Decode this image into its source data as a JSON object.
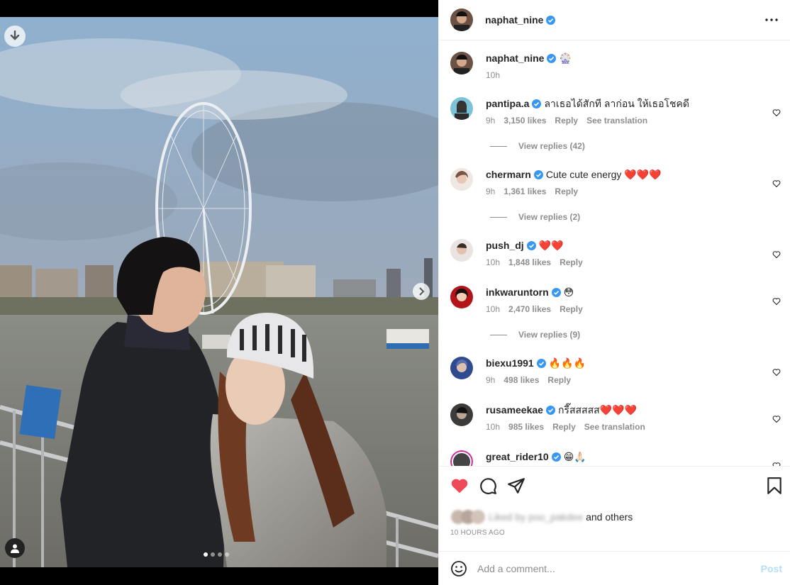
{
  "post": {
    "author": "naphat_nine",
    "caption_emoji": "🎡",
    "caption_time": "10h"
  },
  "comments": [
    {
      "user": "pantipa.a",
      "text": "ลาเธอได้สักที ลาก่อน ให้เธอโชคดี",
      "time": "9h",
      "likes": "3,150 likes",
      "reply": "Reply",
      "translate": "See translation",
      "replies": "View replies (42)"
    },
    {
      "user": "chermarn",
      "text": "Cute cute energy ❤️❤️❤️",
      "time": "9h",
      "likes": "1,361 likes",
      "reply": "Reply",
      "replies": "View replies (2)"
    },
    {
      "user": "push_dj",
      "text": "❤️❤️",
      "time": "10h",
      "likes": "1,848 likes",
      "reply": "Reply"
    },
    {
      "user": "inkwaruntorn",
      "text": "😳",
      "time": "10h",
      "likes": "2,470 likes",
      "reply": "Reply",
      "replies": "View replies (9)"
    },
    {
      "user": "biexu1991",
      "text": "🔥🔥🔥",
      "time": "9h",
      "likes": "498 likes",
      "reply": "Reply"
    },
    {
      "user": "rusameekae",
      "text": "กรี๊สสสสส❤️❤️❤️",
      "time": "10h",
      "likes": "985 likes",
      "reply": "Reply",
      "translate": "See translation"
    },
    {
      "user": "great_rider10",
      "text": "😁🙏🏻"
    }
  ],
  "likes_line": {
    "liked_by": "Liked by poo_pakdee",
    "and_others": "and others"
  },
  "timestamp": "10 HOURS AGO",
  "composer": {
    "placeholder": "Add a comment...",
    "post_label": "Post"
  },
  "colors": {
    "verified": "#3897f0",
    "like_red": "#ed4956",
    "post_disabled": "#b2dffc"
  },
  "icons": [
    "download-icon",
    "chevron-right-icon",
    "user-tag-icon",
    "more-icon",
    "heart-icon",
    "comment-icon",
    "share-icon",
    "bookmark-icon",
    "emoji-icon"
  ]
}
